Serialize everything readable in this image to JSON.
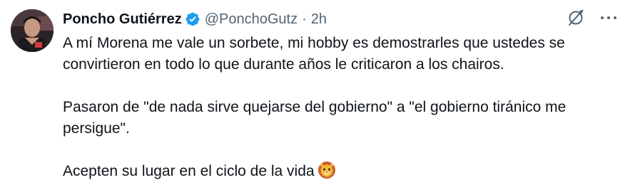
{
  "author": {
    "name": "Poncho Gutiérrez",
    "handle": "@PonchoGutz",
    "separator": "·",
    "time": "2h",
    "verified": true
  },
  "icons": {
    "avatar": "profile-photo",
    "verified": "verified-badge-icon",
    "grok": "grok-icon",
    "more": "more-options-icon",
    "emoji": "lion-face-emoji"
  },
  "colors": {
    "text": "#0f1419",
    "secondary": "#536471",
    "verified": "#1d9bf0"
  },
  "tweet": {
    "line1": "A mí Morena me vale un sorbete, mi hobby es demostrarles que ustedes se",
    "line2": "convirtieron en todo lo que durante años le criticaron a los chairos.",
    "line3": "Pasaron de \"de nada sirve quejarse del gobierno\" a \"el gobierno tiránico me",
    "line4": "persigue\".",
    "line5": "Acepten su lugar en el ciclo de la vida"
  }
}
